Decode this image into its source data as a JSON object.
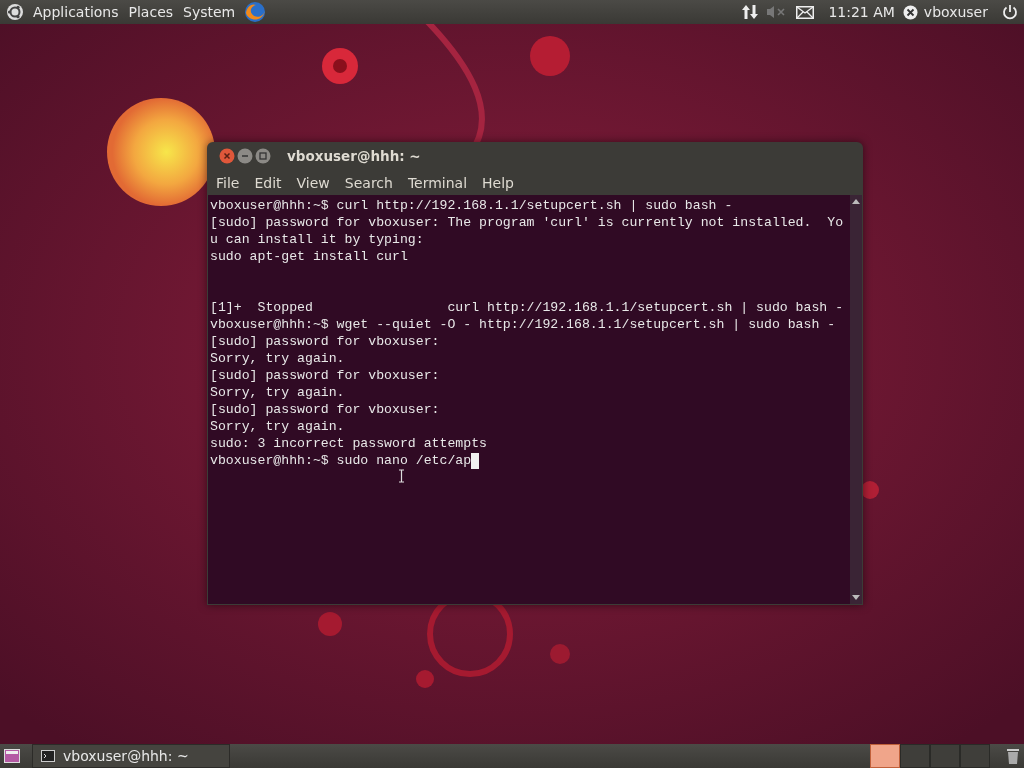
{
  "top_panel": {
    "menus": [
      "Applications",
      "Places",
      "System"
    ],
    "clock": "11:21 AM",
    "volume_muted": true,
    "user": "vboxuser"
  },
  "terminal_window": {
    "title": "vboxuser@hhh: ~",
    "menu": [
      "File",
      "Edit",
      "View",
      "Search",
      "Terminal",
      "Help"
    ],
    "output": [
      [
        "vboxuser@hhh:~$ curl http://192.168.1.1/setupcert.sh | sudo bash -",
        "[sudo] password for vboxuser: The program 'curl' is currently not installed.  Yo",
        "u can install it by typing:",
        "sudo apt-get install curl"
      ],
      [
        "[1]+  Stopped                 curl http://192.168.1.1/setupcert.sh | sudo bash -",
        "vboxuser@hhh:~$ wget --quiet -O - http://192.168.1.1/setupcert.sh | sudo bash -",
        "[sudo] password for vboxuser:",
        "Sorry, try again.",
        "[sudo] password for vboxuser:",
        "Sorry, try again.",
        "[sudo] password for vboxuser:",
        "Sorry, try again.",
        "sudo: 3 incorrect password attempts",
        "vboxuser@hhh:~$ sudo nano /etc/ap"
      ]
    ]
  },
  "bottom_panel": {
    "tasks": [
      {
        "label": "vboxuser@hhh: ~",
        "selected": false
      }
    ],
    "workspaces": [
      {
        "selected": true
      },
      {
        "selected": false
      },
      {
        "selected": false
      },
      {
        "selected": false
      }
    ]
  }
}
